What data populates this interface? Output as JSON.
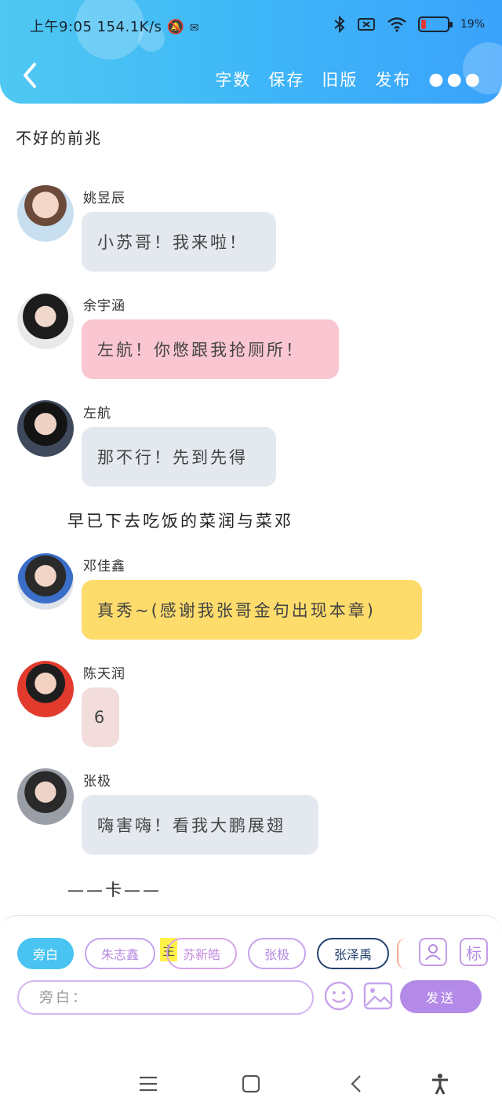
{
  "status": {
    "time": "上午9:05",
    "speed": "154.1K/s",
    "battery_pct": "19%",
    "battery_level": 0.19
  },
  "toolbar": {
    "word_count": "字数",
    "save": "保存",
    "old_version": "旧版",
    "publish": "发布"
  },
  "chapter_title": "不好的前兆",
  "messages": [
    {
      "sender": "姚昱辰",
      "text": "小苏哥！我来啦！",
      "bubble_color": "#e4e8ef"
    },
    {
      "sender": "余宇涵",
      "text": "左航！你憋跟我抢厕所！",
      "bubble_color": "#fac6d1"
    },
    {
      "sender": "左航",
      "text": "那不行！先到先得",
      "bubble_color": "#e4e8ef"
    },
    {
      "sender": "邓佳鑫",
      "text": "真秀~(感谢我张哥金句出现本章)",
      "bubble_color": "#fedc6c"
    },
    {
      "sender": "陈天润",
      "text": "6",
      "bubble_color": "#f2dcdc"
    },
    {
      "sender": "张极",
      "text": "嗨害嗨！看我大鹏展翅",
      "bubble_color": "#e4e8ef"
    }
  ],
  "narrations": [
    "早已下去吃饭的菜润与菜邓",
    "——卡——"
  ],
  "input_panel": {
    "chips": [
      {
        "label": "旁白",
        "style": "filled"
      },
      {
        "label": "朱志鑫",
        "style": "outline"
      },
      {
        "label": "苏新皓",
        "style": "outline"
      },
      {
        "label": "张极",
        "style": "outline"
      },
      {
        "label": "张泽禹",
        "style": "outline-dark"
      }
    ],
    "main_marker": "主",
    "tag_icon_label": "标",
    "placeholder": "旁白：",
    "send": "发送"
  },
  "colors": {
    "header_start": "#4fc8f2",
    "header_end": "#3aa2fb",
    "accent_purple": "#b48ae8",
    "chip_blue": "#49c3f2"
  },
  "icons": [
    "back-icon",
    "more-icon",
    "bluetooth-icon",
    "wifi-icon",
    "battery-icon",
    "contact-icon",
    "tag-icon",
    "emoji-icon",
    "image-icon",
    "menu-icon",
    "home-icon",
    "nav-back-icon",
    "accessibility-icon"
  ]
}
